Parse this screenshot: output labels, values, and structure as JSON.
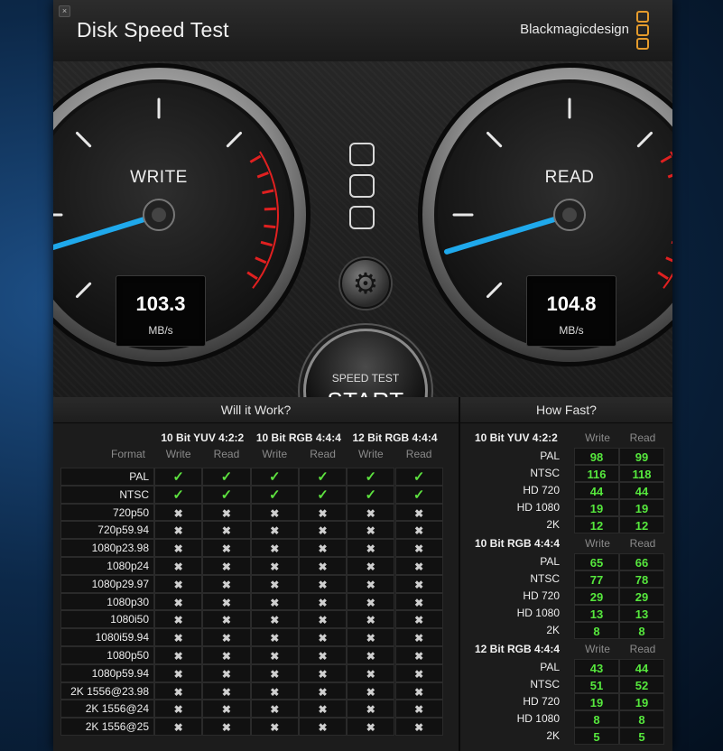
{
  "titlebar": {
    "title": "Disk Speed Test",
    "brand": "Blackmagicdesign"
  },
  "gauges": {
    "write": {
      "label": "WRITE",
      "value": "103.3",
      "unit": "MB/s",
      "speed_mbps": 103.3
    },
    "read": {
      "label": "READ",
      "value": "104.8",
      "unit": "MB/s",
      "speed_mbps": 104.8
    },
    "needle_color": "#1fa9ec",
    "redline_color": "#e02020"
  },
  "start_button": {
    "sub": "SPEED TEST",
    "main": "START"
  },
  "will_it_work": {
    "title": "Will it Work?",
    "format_label": "Format",
    "groups": [
      "10 Bit YUV 4:2:2",
      "10 Bit RGB 4:4:4",
      "12 Bit RGB 4:4:4"
    ],
    "col_labels": [
      "Write",
      "Read"
    ],
    "rows": [
      {
        "format": "PAL",
        "cells": [
          "check",
          "check",
          "check",
          "check",
          "check",
          "check"
        ]
      },
      {
        "format": "NTSC",
        "cells": [
          "check",
          "check",
          "check",
          "check",
          "check",
          "check"
        ]
      },
      {
        "format": "720p50",
        "cells": [
          "cross",
          "cross",
          "cross",
          "cross",
          "cross",
          "cross"
        ]
      },
      {
        "format": "720p59.94",
        "cells": [
          "cross",
          "cross",
          "cross",
          "cross",
          "cross",
          "cross"
        ]
      },
      {
        "format": "1080p23.98",
        "cells": [
          "cross",
          "cross",
          "cross",
          "cross",
          "cross",
          "cross"
        ]
      },
      {
        "format": "1080p24",
        "cells": [
          "cross",
          "cross",
          "cross",
          "cross",
          "cross",
          "cross"
        ]
      },
      {
        "format": "1080p29.97",
        "cells": [
          "cross",
          "cross",
          "cross",
          "cross",
          "cross",
          "cross"
        ]
      },
      {
        "format": "1080p30",
        "cells": [
          "cross",
          "cross",
          "cross",
          "cross",
          "cross",
          "cross"
        ]
      },
      {
        "format": "1080i50",
        "cells": [
          "cross",
          "cross",
          "cross",
          "cross",
          "cross",
          "cross"
        ]
      },
      {
        "format": "1080i59.94",
        "cells": [
          "cross",
          "cross",
          "cross",
          "cross",
          "cross",
          "cross"
        ]
      },
      {
        "format": "1080p50",
        "cells": [
          "cross",
          "cross",
          "cross",
          "cross",
          "cross",
          "cross"
        ]
      },
      {
        "format": "1080p59.94",
        "cells": [
          "cross",
          "cross",
          "cross",
          "cross",
          "cross",
          "cross"
        ]
      },
      {
        "format": "2K 1556@23.98",
        "cells": [
          "cross",
          "cross",
          "cross",
          "cross",
          "cross",
          "cross"
        ]
      },
      {
        "format": "2K 1556@24",
        "cells": [
          "cross",
          "cross",
          "cross",
          "cross",
          "cross",
          "cross"
        ]
      },
      {
        "format": "2K 1556@25",
        "cells": [
          "cross",
          "cross",
          "cross",
          "cross",
          "cross",
          "cross"
        ]
      }
    ],
    "check_glyph": "✓",
    "cross_glyph": "✖"
  },
  "how_fast": {
    "title": "How Fast?",
    "col_labels": [
      "Write",
      "Read"
    ],
    "groups": [
      {
        "name": "10 Bit YUV 4:2:2",
        "rows": [
          {
            "label": "PAL",
            "write": "98",
            "read": "99"
          },
          {
            "label": "NTSC",
            "write": "116",
            "read": "118"
          },
          {
            "label": "HD 720",
            "write": "44",
            "read": "44"
          },
          {
            "label": "HD 1080",
            "write": "19",
            "read": "19"
          },
          {
            "label": "2K",
            "write": "12",
            "read": "12"
          }
        ]
      },
      {
        "name": "10 Bit RGB 4:4:4",
        "rows": [
          {
            "label": "PAL",
            "write": "65",
            "read": "66"
          },
          {
            "label": "NTSC",
            "write": "77",
            "read": "78"
          },
          {
            "label": "HD 720",
            "write": "29",
            "read": "29"
          },
          {
            "label": "HD 1080",
            "write": "13",
            "read": "13"
          },
          {
            "label": "2K",
            "write": "8",
            "read": "8"
          }
        ]
      },
      {
        "name": "12 Bit RGB 4:4:4",
        "rows": [
          {
            "label": "PAL",
            "write": "43",
            "read": "44"
          },
          {
            "label": "NTSC",
            "write": "51",
            "read": "52"
          },
          {
            "label": "HD 720",
            "write": "19",
            "read": "19"
          },
          {
            "label": "HD 1080",
            "write": "8",
            "read": "8"
          },
          {
            "label": "2K",
            "write": "5",
            "read": "5"
          }
        ]
      }
    ]
  }
}
